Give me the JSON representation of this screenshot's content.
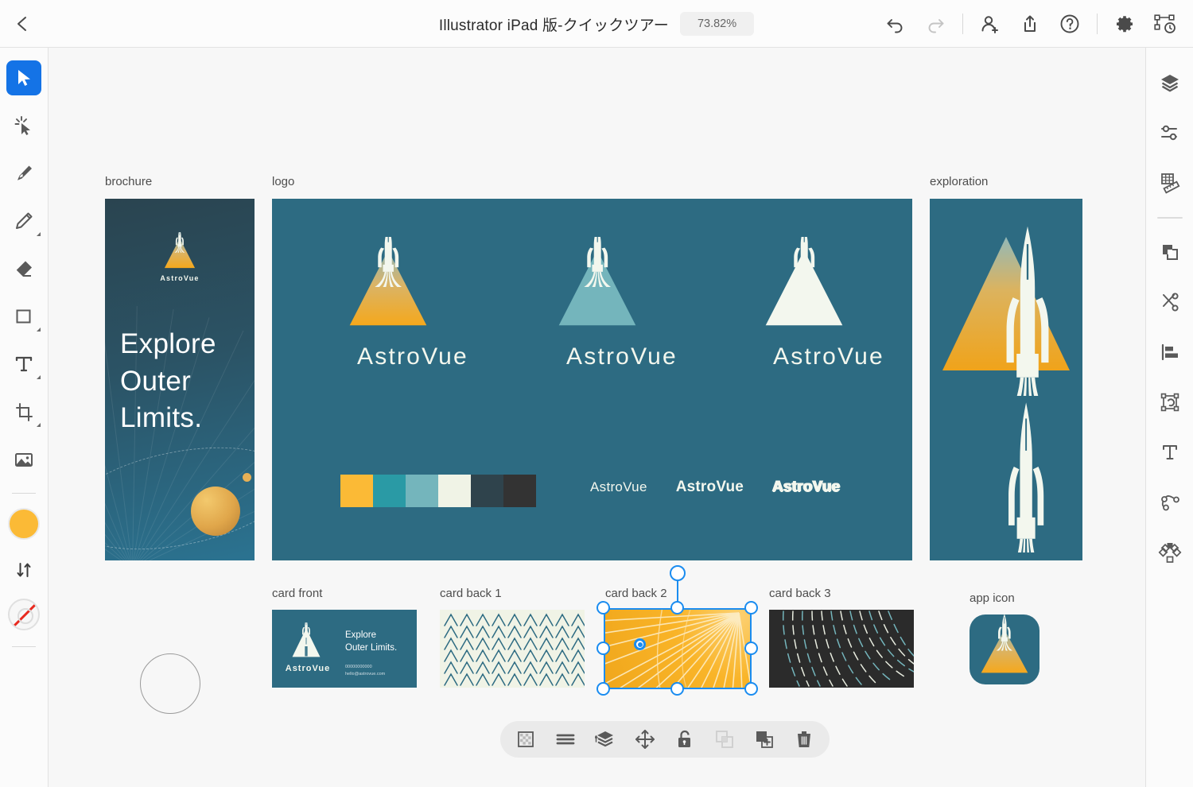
{
  "app": {
    "title": "Illustrator iPad 版-クイックツアー",
    "zoom": "73.82%",
    "back_label": "戻る"
  },
  "top_icons": [
    {
      "name": "undo-icon",
      "label": "Undo"
    },
    {
      "name": "redo-icon",
      "label": "Redo"
    },
    {
      "name": "add-collaborator-icon",
      "label": "Invite"
    },
    {
      "name": "share-icon",
      "label": "Share"
    },
    {
      "name": "help-icon",
      "label": "Help"
    },
    {
      "name": "settings-icon",
      "label": "Settings"
    },
    {
      "name": "preview-publish-icon",
      "label": "Preview"
    }
  ],
  "left_tools": [
    {
      "name": "selection-tool",
      "label": "Selection",
      "active": true
    },
    {
      "name": "magic-wand-tool",
      "label": "Touch type / direct select"
    },
    {
      "name": "pen-tool",
      "label": "Pen"
    },
    {
      "name": "pencil-tool",
      "label": "Pencil"
    },
    {
      "name": "eraser-tool",
      "label": "Eraser"
    },
    {
      "name": "rectangle-tool",
      "label": "Shape"
    },
    {
      "name": "type-tool",
      "label": "Type"
    },
    {
      "name": "artboard-tool",
      "label": "Artboard / Crop"
    },
    {
      "name": "image-tool",
      "label": "Place image"
    }
  ],
  "color_controls": {
    "fill": "#FBBA36",
    "stroke": "none",
    "swap_label": "Swap fill and stroke"
  },
  "right_tools": [
    {
      "name": "layers-panel-icon",
      "label": "Layers"
    },
    {
      "name": "properties-panel-icon",
      "label": "Properties"
    },
    {
      "name": "grid-ruler-icon",
      "label": "Grids & guides"
    },
    {
      "name": "pathfinder-icon",
      "label": "Pathfinder"
    },
    {
      "name": "scissors-icon",
      "label": "Cut / scissors"
    },
    {
      "name": "align-icon",
      "label": "Align"
    },
    {
      "name": "transform-icon",
      "label": "Transform"
    },
    {
      "name": "text-panel-icon",
      "label": "Type settings"
    },
    {
      "name": "path-curve-icon",
      "label": "Path edit"
    },
    {
      "name": "repeat-radial-icon",
      "label": "Repeat"
    }
  ],
  "context_toolbar": [
    {
      "name": "opacity-icon",
      "label": "Opacity",
      "disabled": false
    },
    {
      "name": "align-menu-icon",
      "label": "Align",
      "disabled": false
    },
    {
      "name": "arrange-icon",
      "label": "Arrange",
      "disabled": false
    },
    {
      "name": "move-transform-icon",
      "label": "Move",
      "disabled": false
    },
    {
      "name": "unlock-icon",
      "label": "Lock",
      "disabled": false
    },
    {
      "name": "group-icon",
      "label": "Group",
      "disabled": true
    },
    {
      "name": "duplicate-icon",
      "label": "Duplicate",
      "disabled": false
    },
    {
      "name": "delete-icon",
      "label": "Delete",
      "disabled": false
    }
  ],
  "artboards": {
    "brochure": {
      "label": "brochure",
      "logo_word": "AstroVue",
      "headline": "Explore\nOuter\nLimits."
    },
    "logo": {
      "label": "logo",
      "logo_word": "AstroVue",
      "swatches": [
        "#FBBA36",
        "#2A9AA5",
        "#74B5BC",
        "#F0F3E6",
        "#2F434C",
        "#333333"
      ],
      "wordmarks": [
        "AstroVue",
        "AstroVue",
        "AstroVue"
      ]
    },
    "exploration": {
      "label": "exploration"
    },
    "card_front": {
      "label": "card front",
      "logo_word": "AstroVue",
      "tagline": "Explore\nOuter Limits.",
      "phone": "00000000000",
      "email": "hello@astrovue.com"
    },
    "card_back1": {
      "label": "card back 1"
    },
    "card_back2": {
      "label": "card back 2",
      "selected": true
    },
    "card_back3": {
      "label": "card back 3"
    },
    "app_icon": {
      "label": "app icon"
    }
  },
  "colors": {
    "accent": "#1473E6",
    "selection": "#1A8CF0",
    "brand_teal": "#2D6B82",
    "brand_amber": "#FBBA36",
    "brand_cream": "#F0F3E6",
    "brand_dark": "#2A4450"
  }
}
